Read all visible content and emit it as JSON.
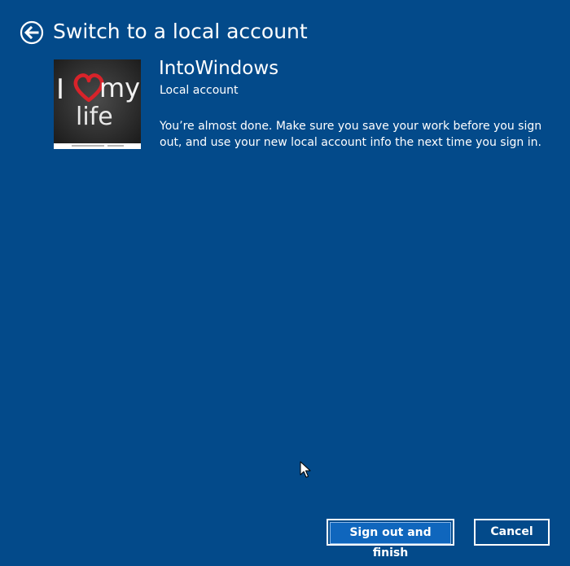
{
  "header": {
    "title": "Switch to a local account",
    "back_icon": "arrow-left-circle-icon"
  },
  "account": {
    "avatar_text_line1": "I",
    "avatar_text_my": "my",
    "avatar_text_line2": "life",
    "name": "IntoWindows",
    "type": "Local account"
  },
  "message": "You’re almost done. Make sure you save your work before you sign out, and use your new local account info the next time you sign in.",
  "buttons": {
    "primary": "Sign out and finish",
    "cancel": "Cancel"
  },
  "colors": {
    "background": "#034a8a",
    "primary_fill": "#0f66bd",
    "text": "#ffffff",
    "heart": "#d8232a"
  }
}
